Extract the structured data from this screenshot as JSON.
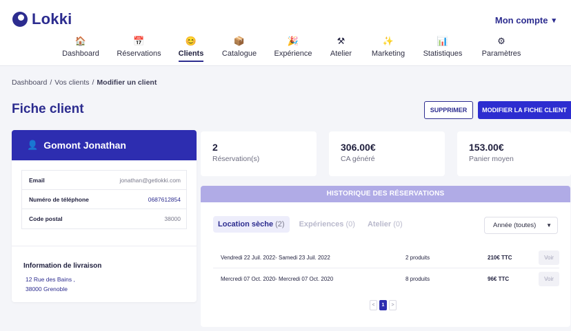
{
  "app": {
    "name": "Lokki",
    "account_label": "Mon compte"
  },
  "nav": [
    {
      "label": "Dashboard",
      "icon": "house-icon",
      "glyph": "🏠"
    },
    {
      "label": "Réservations",
      "icon": "calendar-icon",
      "glyph": "📅"
    },
    {
      "label": "Clients",
      "icon": "smiley-icon",
      "glyph": "😊",
      "active": true
    },
    {
      "label": "Catalogue",
      "icon": "box-icon",
      "glyph": "📦"
    },
    {
      "label": "Expérience",
      "icon": "party-icon",
      "glyph": "🎉"
    },
    {
      "label": "Atelier",
      "icon": "tools-icon",
      "glyph": "⚒"
    },
    {
      "label": "Marketing",
      "icon": "sparkle-icon",
      "glyph": "✨"
    },
    {
      "label": "Statistiques",
      "icon": "bar-chart-icon",
      "glyph": "📊"
    },
    {
      "label": "Paramètres",
      "icon": "gear-icon",
      "glyph": "⚙"
    }
  ],
  "breadcrumb": {
    "items": [
      "Dashboard",
      "Vos clients"
    ],
    "current": "Modifier un client"
  },
  "page": {
    "title": "Fiche client",
    "delete_label": "SUPPRIMER",
    "edit_label": "MODIFIER LA FICHE CLIENT"
  },
  "client": {
    "name": "Gomont Jonathan",
    "fields": [
      {
        "label": "Email",
        "value": "jonathan@getlokki.com"
      },
      {
        "label": "Numéro de téléphone",
        "value": "0687612854"
      },
      {
        "label": "Code postal",
        "value": "38000"
      }
    ],
    "delivery_title": "Information de livraison",
    "address_line1": "12 Rue des Bains ,",
    "address_line2": "38000 Grenoble"
  },
  "stats": [
    {
      "value": "2",
      "label": "Réservation(s)"
    },
    {
      "value": "306.00€",
      "label": "CA généré"
    },
    {
      "value": "153.00€",
      "label": "Panier moyen"
    }
  ],
  "history": {
    "title": "HISTORIQUE DES RÉSERVATIONS",
    "tabs": [
      {
        "label": "Location sèche",
        "count": "(2)",
        "active": true
      },
      {
        "label": "Expériences",
        "count": "(0)"
      },
      {
        "label": "Atelier",
        "count": "(0)"
      }
    ],
    "year_select": "Année (toutes)",
    "rows": [
      {
        "dates": "Vendredi 22 Juil. 2022- Samedi 23 Juil. 2022",
        "products": "2 produits",
        "price": "210€ TTC",
        "action": "Voir"
      },
      {
        "dates": "Mercredi 07 Oct. 2020- Mercredi 07 Oct. 2020",
        "products": "8 produits",
        "price": "96€ TTC",
        "action": "Voir"
      }
    ],
    "pager": {
      "prev": "<",
      "current": "1",
      "next": ">"
    }
  }
}
